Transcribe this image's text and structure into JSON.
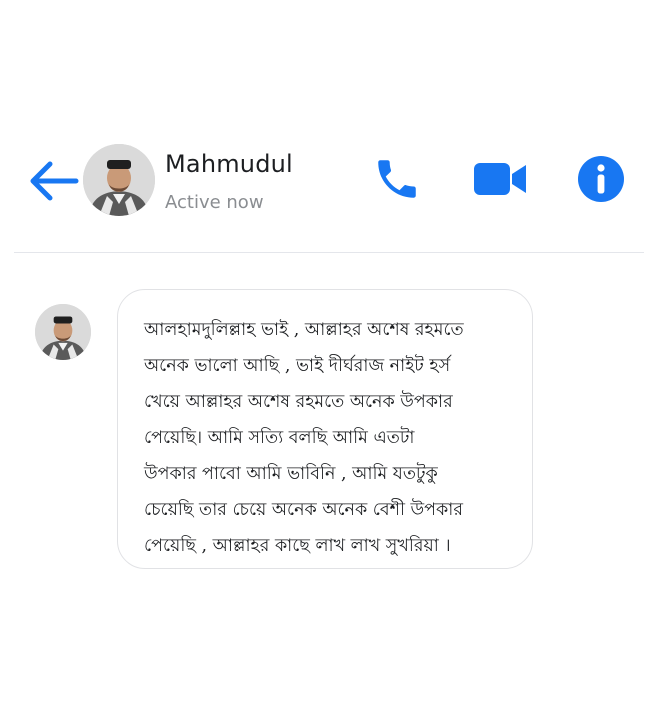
{
  "header": {
    "contact_name": "Mahmudul",
    "status": "Active now",
    "back_icon": "arrow-left-icon",
    "call_icon": "phone-icon",
    "video_icon": "video-camera-icon",
    "info_icon": "info-icon"
  },
  "colors": {
    "accent": "#1877f2",
    "divider": "#e4e6eb",
    "bubble_border": "#e1e2e5",
    "status_text": "#8a8d91"
  },
  "message": {
    "text": "আলহামদুলিল্লাহ ভাই , আল্লাহর অশেষ রহমতে\nঅনেক ভালো আছি , ভাই দীর্ঘরাজ নাইট হর্স\nখেয়ে আল্লাহর অশেষ রহমতে অনেক উপকার\nপেয়েছি। আমি সত্যি বলছি আমি এতটা\nউপকার পাবো আমি ভাবিনি , আমি যতটুকু\nচেয়েছি তার চেয়ে অনেক অনেক বেশী উপকার\nপেয়েছি , আল্লাহর কাছে লাখ লাখ সুখরিয়া ।"
  }
}
